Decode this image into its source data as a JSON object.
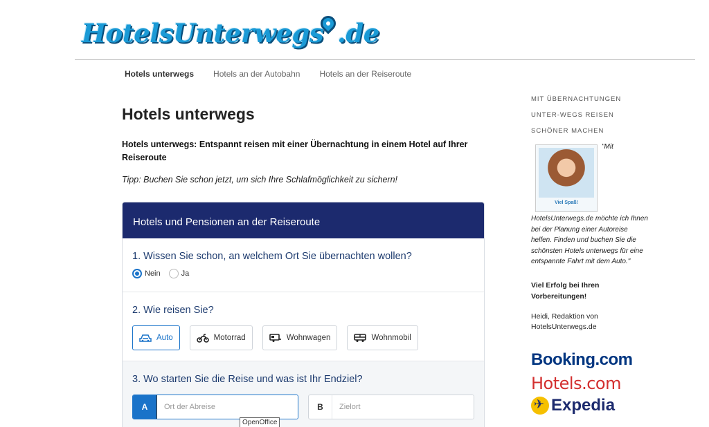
{
  "header": {
    "logo_text_a": "HotelsUnterwegs",
    "logo_text_b": ".de"
  },
  "nav": {
    "items": [
      "Hotels unterwegs",
      "Hotels an der Autobahn",
      "Hotels an der Reiseroute"
    ]
  },
  "main": {
    "title": "Hotels unterwegs",
    "intro": "Hotels unterwegs: Entspannt reisen mit einer Übernachtung in einem Hotel auf Ihrer Reiseroute",
    "tip": "Tipp: Buchen Sie schon jetzt, um sich Ihre Schlafmöglichkeit zu sichern!"
  },
  "card": {
    "title": "Hotels und Pensionen an der Reiseroute",
    "q1": "1. Wissen Sie schon, an welchem Ort Sie übernachten wollen?",
    "q1_options": [
      "Nein",
      "Ja"
    ],
    "q1_selected": "Nein",
    "q2": "2. Wie reisen Sie?",
    "q2_options": [
      "Auto",
      "Motorrad",
      "Wohnwagen",
      "Wohnmobil"
    ],
    "q2_selected": "Auto",
    "q3": "3. Wo starten Sie die Reise und was ist Ihr Endziel?",
    "field_a_label": "A",
    "field_a_placeholder": "Ort der Abreise",
    "field_b_label": "B",
    "field_b_placeholder": "Zielort"
  },
  "tooltip": "OpenOffice",
  "sidebar": {
    "title": "MIT ÜBERNACHTUNGEN UNTER-WEGS REISEN SCHÖNER MACHEN",
    "photo_caption": "Viel Spaß!",
    "quote": "\"Mit HotelsUnterwegs.de möchte ich Ihnen bei der Planung einer Autoreise helfen. Finden und buchen Sie die schönsten Hotels unterwegs für eine entspannte Fahrt mit dem Auto.\"",
    "strong": "Viel Erfolg bei Ihren Vorbereitungen!",
    "signature": "Heidi, Redaktion von HotelsUnterwegs.de",
    "brands": [
      "Booking.com",
      "Hotels.com",
      "Expedia"
    ]
  },
  "colors": {
    "card_header": "#1c2a6e",
    "accent": "#1a73c9",
    "logo": "#1a9ad6"
  }
}
